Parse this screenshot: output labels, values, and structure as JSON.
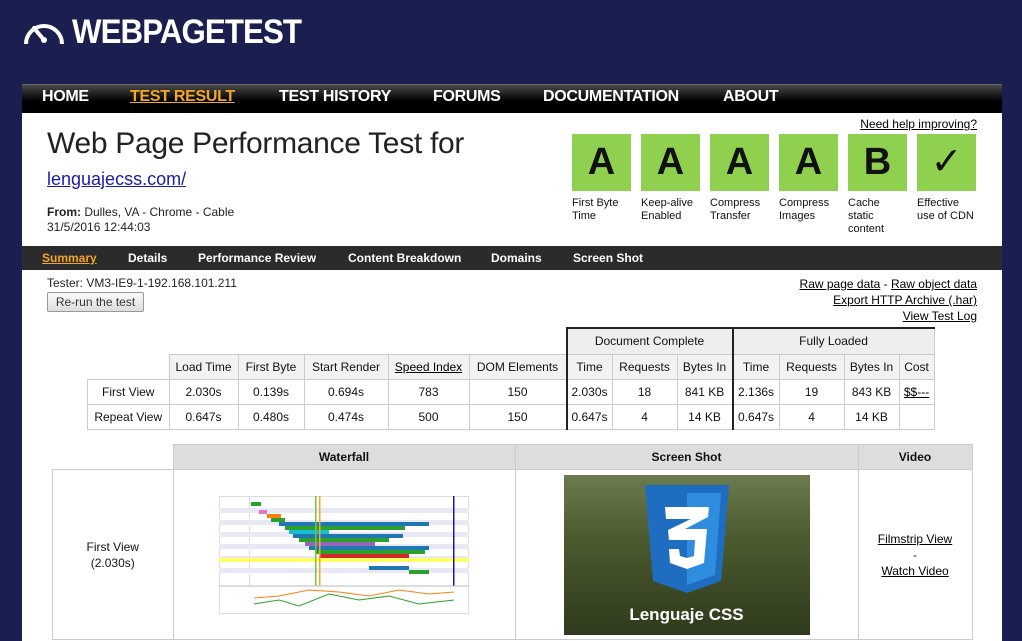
{
  "logo": {
    "text": "WEBPAGETEST"
  },
  "nav": [
    {
      "label": "HOME",
      "active": false
    },
    {
      "label": "TEST RESULT",
      "active": true
    },
    {
      "label": "TEST HISTORY",
      "active": false
    },
    {
      "label": "FORUMS",
      "active": false
    },
    {
      "label": "DOCUMENTATION",
      "active": false
    },
    {
      "label": "ABOUT",
      "active": false
    }
  ],
  "header": {
    "title": "Web Page Performance Test for",
    "url": "lenguajecss.com/",
    "from_label": "From:",
    "from_value": "Dulles, VA - Chrome - Cable",
    "datetime": "31/5/2016 12:44:03",
    "help_link": "Need help improving?"
  },
  "grades": [
    {
      "grade": "A",
      "label": "First Byte Time"
    },
    {
      "grade": "A",
      "label": "Keep-alive Enabled"
    },
    {
      "grade": "A",
      "label": "Compress Transfer"
    },
    {
      "grade": "A",
      "label": "Compress Images"
    },
    {
      "grade": "B",
      "label": "Cache static content"
    },
    {
      "grade": "✓",
      "label": "Effective use of CDN"
    }
  ],
  "subnav": [
    {
      "label": "Summary",
      "active": true
    },
    {
      "label": "Details",
      "active": false
    },
    {
      "label": "Performance Review",
      "active": false
    },
    {
      "label": "Content Breakdown",
      "active": false
    },
    {
      "label": "Domains",
      "active": false
    },
    {
      "label": "Screen Shot",
      "active": false
    }
  ],
  "tester": "Tester: VM3-IE9-1-192.168.101.211",
  "rerun_label": "Re-run the test",
  "right_links": [
    "Raw page data",
    "Raw object data",
    "Export HTTP Archive (.har)",
    "View Test Log"
  ],
  "results": {
    "group_document": "Document Complete",
    "group_fully": "Fully Loaded",
    "headers": [
      "Load Time",
      "First Byte",
      "Start Render",
      "Speed Index",
      "DOM Elements",
      "Time",
      "Requests",
      "Bytes In",
      "Time",
      "Requests",
      "Bytes In",
      "Cost"
    ],
    "rows": [
      {
        "label": "First View",
        "cells": [
          "2.030s",
          "0.139s",
          "0.694s",
          "783",
          "150",
          "2.030s",
          "18",
          "841 KB",
          "2.136s",
          "19",
          "843 KB",
          "$$---"
        ]
      },
      {
        "label": "Repeat View",
        "cells": [
          "0.647s",
          "0.480s",
          "0.474s",
          "500",
          "150",
          "0.647s",
          "4",
          "14 KB",
          "0.647s",
          "4",
          "14 KB",
          ""
        ]
      }
    ]
  },
  "media": {
    "headers": [
      "Waterfall",
      "Screen Shot",
      "Video"
    ],
    "row_label": "First View",
    "row_time": "(2.030s)",
    "screenshot_caption": "Lenguaje CSS",
    "video_links": [
      "Filmstrip View",
      "-",
      "Watch Video"
    ]
  },
  "colors": {
    "background": "#1b1f4f",
    "accent": "#f5a623",
    "grade_green": "#8fd14f"
  }
}
